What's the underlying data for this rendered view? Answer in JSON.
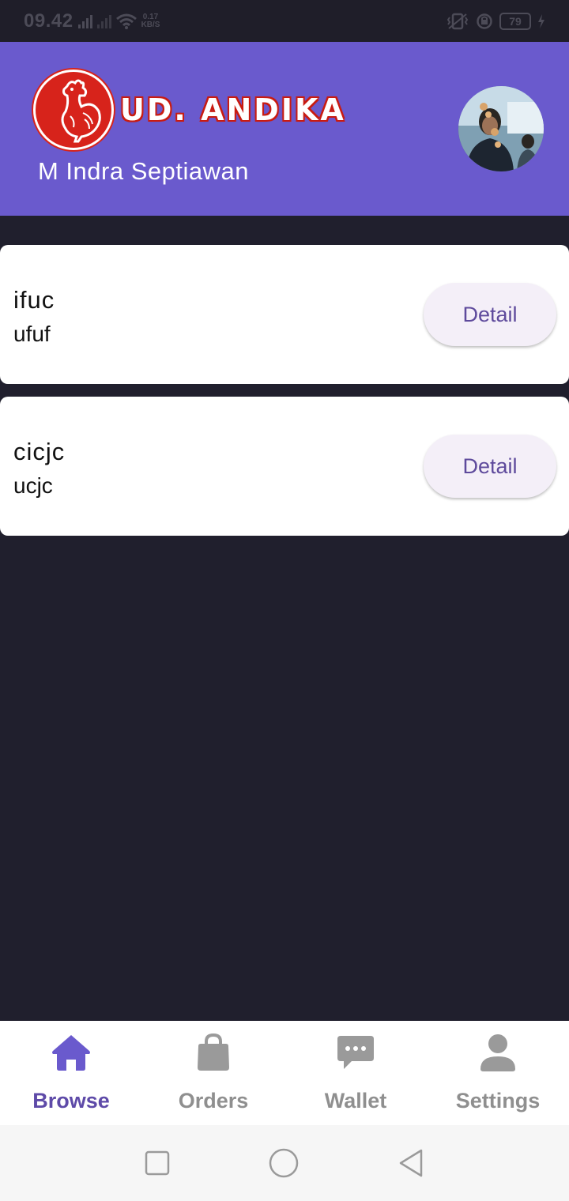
{
  "status_bar": {
    "time": "09.42",
    "net_speed_value": "0.17",
    "net_speed_unit": "KB/S",
    "battery": "79"
  },
  "header": {
    "brand": "UD. ANDIKA",
    "user_name": "M Indra Septiawan",
    "background_color": "#6a5acd"
  },
  "items": [
    {
      "title": "ifuc",
      "subtitle": "ufuf",
      "button_label": "Detail"
    },
    {
      "title": "cicjc",
      "subtitle": "ucjc",
      "button_label": "Detail"
    }
  ],
  "bottom_nav": {
    "items": [
      {
        "label": "Browse",
        "icon": "home-icon",
        "active": true
      },
      {
        "label": "Orders",
        "icon": "shopping-bag-icon",
        "active": false
      },
      {
        "label": "Wallet",
        "icon": "chat-bubble-icon",
        "active": false
      },
      {
        "label": "Settings",
        "icon": "person-icon",
        "active": false
      }
    ],
    "active_color": "#5e4aa8",
    "inactive_color": "#8f8f8f"
  },
  "system_nav": {
    "buttons": [
      "recents-icon",
      "home-circle-icon",
      "back-icon"
    ]
  }
}
